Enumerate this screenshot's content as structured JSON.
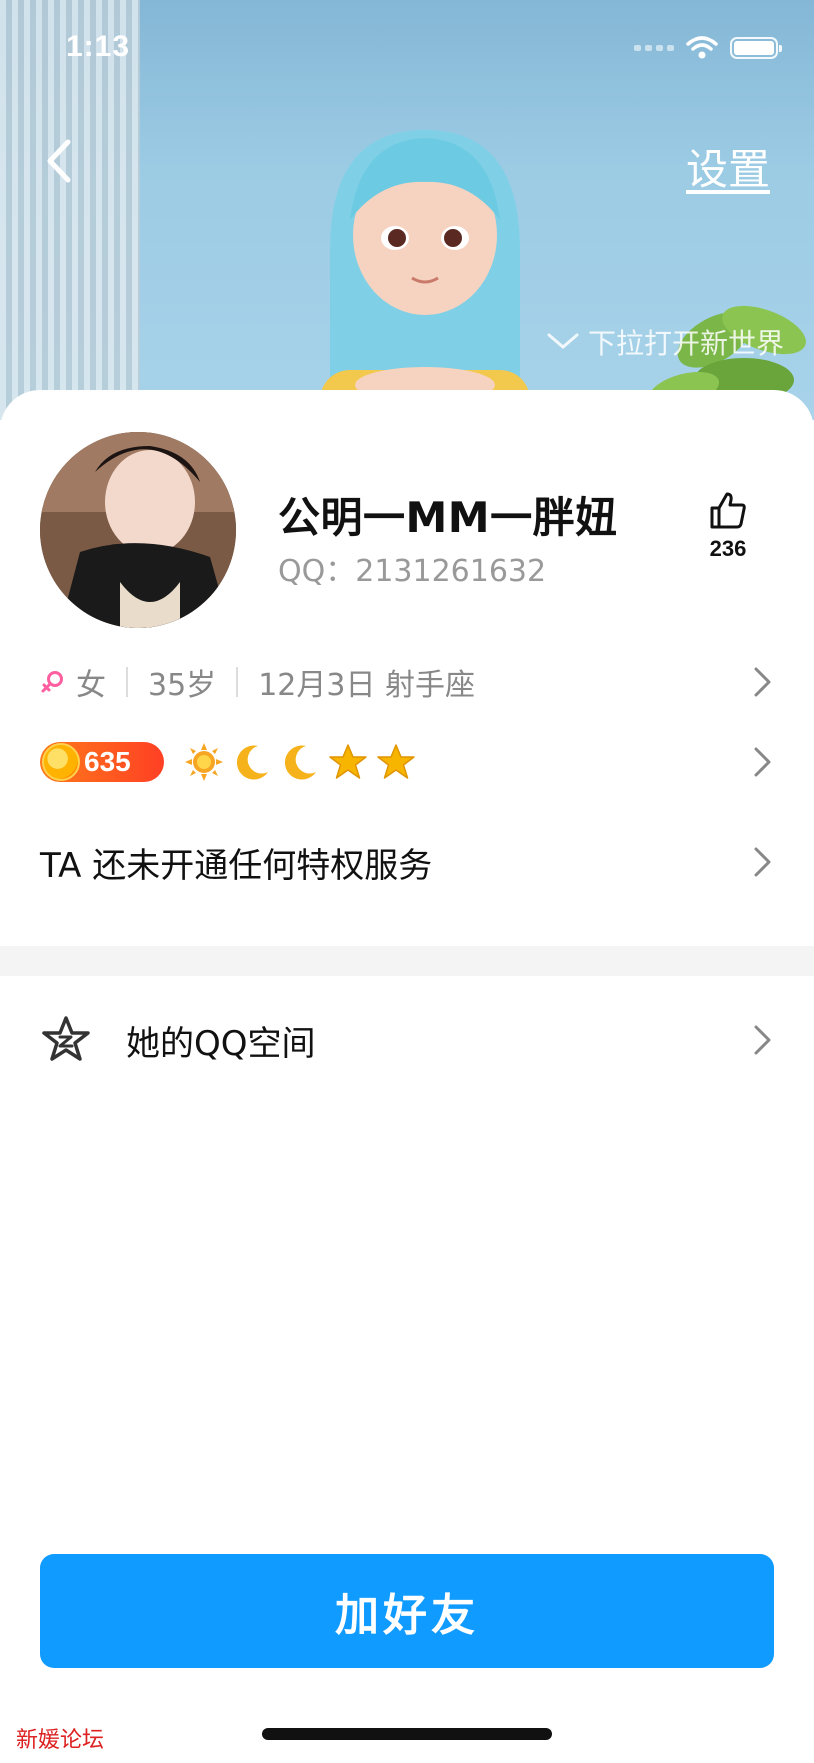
{
  "status_bar": {
    "time": "1:13"
  },
  "header": {
    "settings_label": "设置",
    "pull_hint": "下拉打开新世界"
  },
  "profile": {
    "nickname": "公明一MM一胖妞",
    "qq_label": "QQ：2131261632",
    "like_count": "236"
  },
  "info": {
    "gender": "女",
    "age": "35岁",
    "birthday_sign": "12月3日 射手座",
    "gender_color": "#ff5fa0"
  },
  "level": {
    "value": "635",
    "icons": [
      "sun-icon",
      "moon-icon",
      "moon-icon",
      "star-icon",
      "star-icon"
    ]
  },
  "privilege": {
    "text": "TA 还未开通任何特权服务"
  },
  "qzone": {
    "label": "她的QQ空间"
  },
  "actions": {
    "add_friend_label": "加好友",
    "accent_color": "#0f9bff"
  },
  "watermark": {
    "text": "新媛论坛"
  }
}
